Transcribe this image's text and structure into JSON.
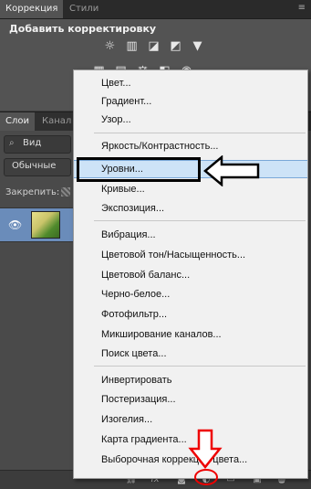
{
  "top_panel": {
    "tabs": [
      {
        "label": "Коррекция",
        "active": true
      },
      {
        "label": "Стили",
        "active": false
      }
    ],
    "title": "Добавить корректировку"
  },
  "layers_panel": {
    "tabs": [
      {
        "label": "Слои",
        "active": true
      },
      {
        "label": "Канал",
        "active": false
      }
    ],
    "search_placeholder": "Вид",
    "blend_mode": "Обычные",
    "lock_label": "Закрепить:"
  },
  "menu": {
    "groups": [
      [
        "Цвет...",
        "Градиент...",
        "Узор..."
      ],
      [
        "Яркость/Контрастность...",
        "Уровни...",
        "Кривые...",
        "Экспозиция..."
      ],
      [
        "Вибрация...",
        "Цветовой тон/Насыщенность...",
        "Цветовой баланс...",
        "Черно-белое...",
        "Фотофильтр...",
        "Микширование каналов...",
        "Поиск цвета..."
      ],
      [
        "Инвертировать",
        "Постеризация...",
        "Изогелия...",
        "Карта градиента...",
        "Выборочная коррекция цвета..."
      ]
    ],
    "highlighted": "Уровни..."
  },
  "annotations": {
    "box_color": "#000000",
    "arrow_color": "#000000",
    "circle_color": "#e00000"
  },
  "bottom_bar_icons": [
    "link-icon",
    "fx-icon",
    "mask-icon",
    "adjustment-layer-icon",
    "group-icon",
    "new-layer-icon",
    "trash-icon"
  ]
}
